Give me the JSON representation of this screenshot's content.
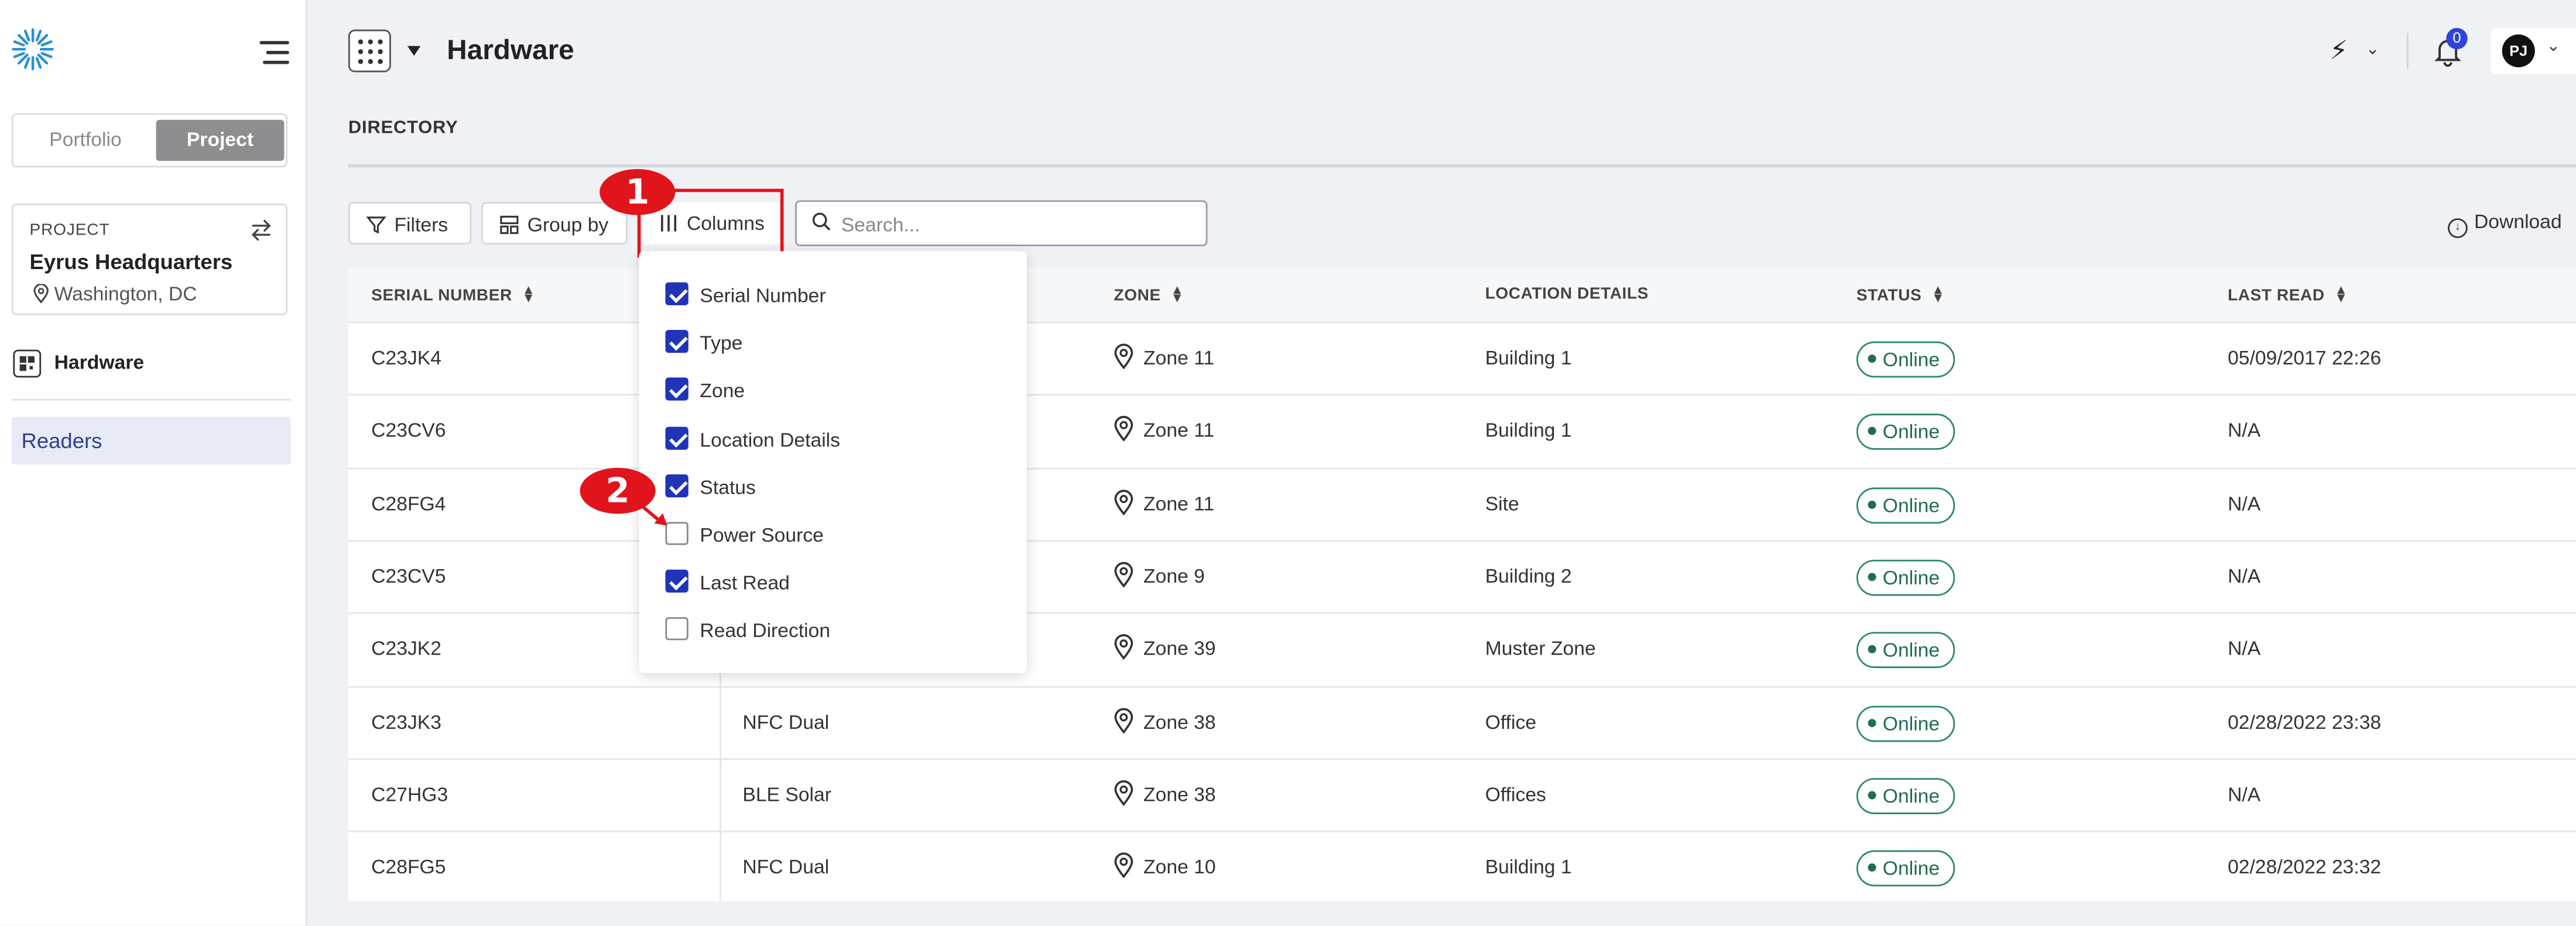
{
  "sidebar": {
    "toggle": {
      "portfolio": "Portfolio",
      "project": "Project"
    },
    "project_card": {
      "label": "PROJECT",
      "name": "Eyrus Headquarters",
      "location": "Washington, DC"
    },
    "nav": {
      "hardware": "Hardware",
      "readers": "Readers"
    }
  },
  "header": {
    "title": "Hardware",
    "notification_count": "0",
    "user_initials": "PJ"
  },
  "section_title": "DIRECTORY",
  "toolbar": {
    "filters": "Filters",
    "group_by": "Group by",
    "columns": "Columns",
    "search_placeholder": "Search...",
    "download": "Download"
  },
  "table": {
    "headers": {
      "serial": "SERIAL NUMBER",
      "zone": "ZONE",
      "location": "LOCATION DETAILS",
      "status": "STATUS",
      "last_read": "LAST READ"
    },
    "rows": [
      {
        "serial": "C23JK4",
        "type": "",
        "zone": "Zone 11",
        "location": "Building 1",
        "status": "Online",
        "last_read": "05/09/2017 22:26"
      },
      {
        "serial": "C23CV6",
        "type": "",
        "zone": "Zone 11",
        "location": "Building 1",
        "status": "Online",
        "last_read": "N/A"
      },
      {
        "serial": "C28FG4",
        "type": "",
        "zone": "Zone 11",
        "location": "Site",
        "status": "Online",
        "last_read": "N/A"
      },
      {
        "serial": "C23CV5",
        "type": "",
        "zone": "Zone 9",
        "location": "Building 2",
        "status": "Online",
        "last_read": "N/A"
      },
      {
        "serial": "C23JK2",
        "type": "",
        "zone": "Zone 39",
        "location": "Muster Zone",
        "status": "Online",
        "last_read": "N/A"
      },
      {
        "serial": "C23JK3",
        "type": "NFC Dual",
        "zone": "Zone 38",
        "location": "Office",
        "status": "Online",
        "last_read": "02/28/2022 23:38"
      },
      {
        "serial": "C27HG3",
        "type": "BLE Solar",
        "zone": "Zone 38",
        "location": "Offices",
        "status": "Online",
        "last_read": "N/A"
      },
      {
        "serial": "C28FG5",
        "type": "NFC Dual",
        "zone": "Zone 10",
        "location": "Building 1",
        "status": "Online",
        "last_read": "02/28/2022 23:32"
      }
    ]
  },
  "columns_menu": [
    {
      "label": "Serial Number",
      "checked": true
    },
    {
      "label": "Type",
      "checked": true
    },
    {
      "label": "Zone",
      "checked": true
    },
    {
      "label": "Location Details",
      "checked": true
    },
    {
      "label": "Status",
      "checked": true
    },
    {
      "label": "Power Source",
      "checked": false
    },
    {
      "label": "Last Read",
      "checked": true
    },
    {
      "label": "Read Direction",
      "checked": false
    }
  ],
  "annotations": {
    "marker1": "1",
    "marker2": "2"
  },
  "colors": {
    "accent": "#2034b8",
    "highlight": "#e1141c",
    "status_online": "#1f6e4c",
    "nav_active": "#e8ebf6"
  }
}
